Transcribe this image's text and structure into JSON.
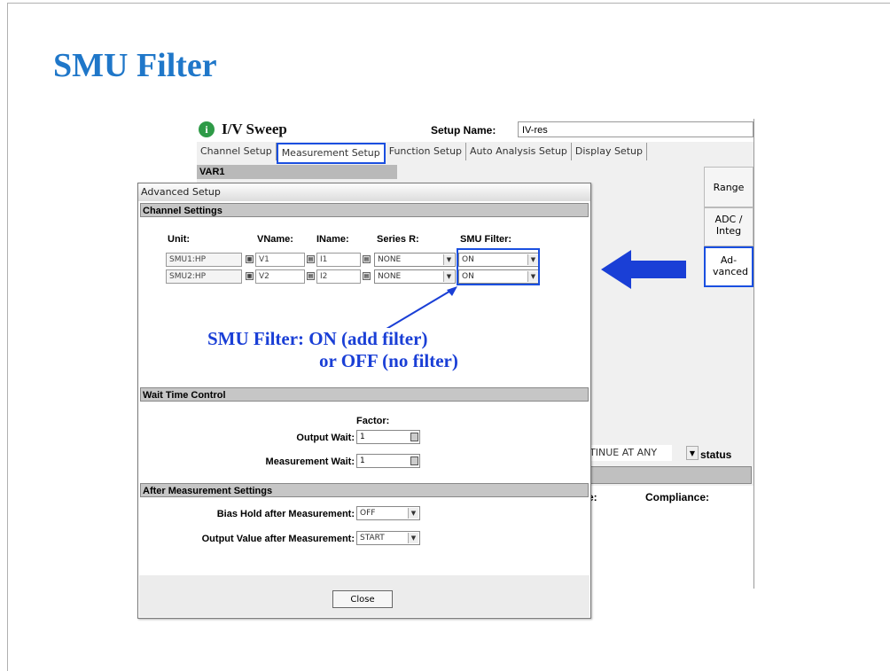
{
  "slide": {
    "title": "SMU Filter"
  },
  "main_window": {
    "title": "I/V Sweep",
    "setup_name_label": "Setup Name:",
    "setup_name_value": "IV-res",
    "tabs": [
      {
        "label": "Channel Setup"
      },
      {
        "label": "Measurement Setup",
        "active": true
      },
      {
        "label": "Function Setup"
      },
      {
        "label": "Auto Analysis Setup"
      },
      {
        "label": "Display Setup"
      }
    ],
    "var1_label": "VAR1",
    "side_buttons": [
      {
        "label": "Range"
      },
      {
        "label": "ADC / Integ"
      },
      {
        "label": "Ad- vanced"
      }
    ],
    "continue_value": "TINUE AT ANY",
    "status_label": "status",
    "partial_label": "e:",
    "compliance_label": "Compliance:"
  },
  "dialog": {
    "title": "Advanced Setup",
    "channel_settings": {
      "header": "Channel Settings",
      "columns": [
        "Unit:",
        "VName:",
        "IName:",
        "Series R:",
        "SMU Filter:"
      ],
      "rows": [
        {
          "unit": "SMU1:HP",
          "vname": "V1",
          "iname": "I1",
          "series_r": "NONE",
          "smu_filter": "ON"
        },
        {
          "unit": "SMU2:HP",
          "vname": "V2",
          "iname": "I2",
          "series_r": "NONE",
          "smu_filter": "ON"
        }
      ]
    },
    "annotation_line1": "SMU Filter: ON (add filter)",
    "annotation_line2": "or OFF (no filter)",
    "wait_time": {
      "header": "Wait Time Control",
      "factor_label": "Factor:",
      "output_wait_label": "Output Wait:",
      "output_wait_value": "1",
      "measurement_wait_label": "Measurement Wait:",
      "measurement_wait_value": "1"
    },
    "after_measurement": {
      "header": "After Measurement Settings",
      "bias_hold_label": "Bias Hold after Measurement:",
      "bias_hold_value": "OFF",
      "output_value_label": "Output Value after Measurement:",
      "output_value_value": "START"
    },
    "close_label": "Close"
  },
  "colors": {
    "title": "#1f77c9",
    "highlight": "#1a4fe0",
    "arrow": "#1a3fd6"
  }
}
